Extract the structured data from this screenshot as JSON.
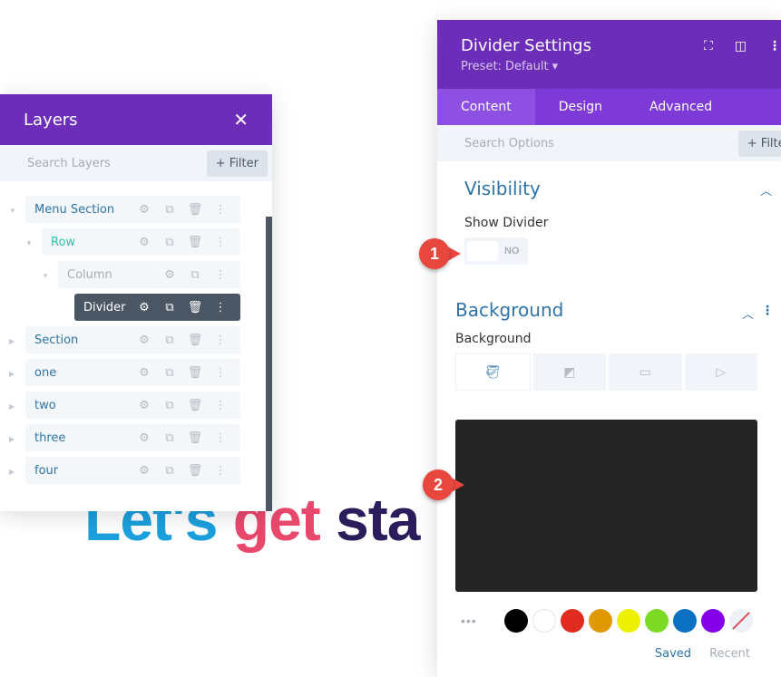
{
  "headline": {
    "part1": "Let's",
    "part2": "get",
    "part3": "sta"
  },
  "layers": {
    "title": "Layers",
    "search_placeholder": "Search Layers",
    "filter_label": "+ Filter",
    "items": [
      {
        "label": "Menu Section",
        "level": 0,
        "expanded": true,
        "color": "#2e74a8"
      },
      {
        "label": "Row",
        "level": 1,
        "expanded": true,
        "color": "#29c4a9"
      },
      {
        "label": "Column",
        "level": 2,
        "expanded": true,
        "color": "#a6adb6"
      },
      {
        "label": "Divider",
        "level": 3,
        "active": true
      },
      {
        "label": "Section",
        "level": 0,
        "expanded": false
      },
      {
        "label": "one",
        "level": 0,
        "expanded": false
      },
      {
        "label": "two",
        "level": 0,
        "expanded": false
      },
      {
        "label": "three",
        "level": 0,
        "expanded": false
      },
      {
        "label": "four",
        "level": 0,
        "expanded": false
      }
    ]
  },
  "settings": {
    "title": "Divider Settings",
    "preset": "Preset: Default ▾",
    "tabs": [
      "Content",
      "Design",
      "Advanced"
    ],
    "active_tab": "Content",
    "search_placeholder": "Search Options",
    "filter_label": "+ Filter",
    "visibility": {
      "title": "Visibility",
      "field_label": "Show Divider",
      "toggle_value": "NO"
    },
    "background": {
      "title": "Background",
      "field_label": "Background",
      "preview_color": "#242424",
      "swatches": [
        "#000000",
        "#ffffff",
        "#e02b20",
        "#e09900",
        "#edf000",
        "#7cda24",
        "#0c71c3",
        "#8300e9"
      ],
      "saved_label": "Saved",
      "recent_label": "Recent"
    }
  },
  "callouts": [
    "1",
    "2"
  ]
}
